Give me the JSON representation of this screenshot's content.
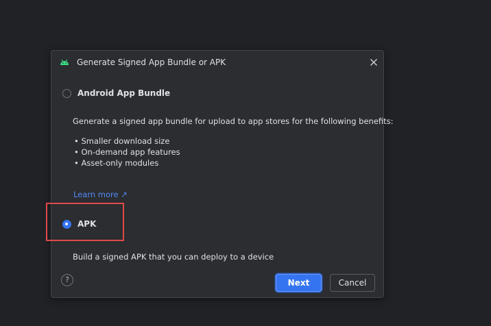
{
  "dialog": {
    "title": "Generate Signed App Bundle or APK",
    "close_icon": "close-icon",
    "app_icon": "android-icon"
  },
  "options": {
    "bundle": {
      "label": "Android App Bundle",
      "selected": false,
      "description": "Generate a signed app bundle for upload to app stores for the following benefits:",
      "benefits": [
        "Smaller download size",
        "On-demand app features",
        "Asset-only modules"
      ],
      "learn_more": "Learn more ↗"
    },
    "apk": {
      "label": "APK",
      "selected": true,
      "description": "Build a signed APK that you can deploy to a device"
    }
  },
  "footer": {
    "help_label": "?",
    "next_label": "Next",
    "cancel_label": "Cancel"
  },
  "colors": {
    "accent": "#3574f0",
    "link": "#548af7",
    "highlight": "#e04a4a",
    "background": "#2b2d30"
  }
}
